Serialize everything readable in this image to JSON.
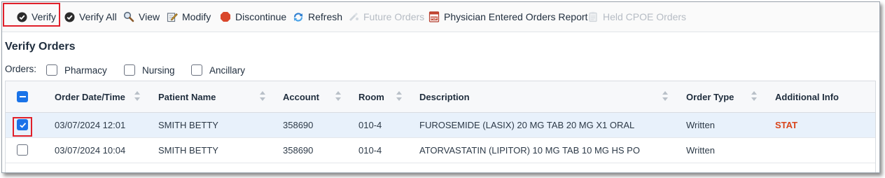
{
  "toolbar": {
    "items": [
      {
        "label": "Verify",
        "icon": "check-circle-icon",
        "enabled": true
      },
      {
        "label": "Verify All",
        "icon": "check-circle-icon",
        "enabled": true
      },
      {
        "label": "View",
        "icon": "magnifier-icon",
        "enabled": true
      },
      {
        "label": "Modify",
        "icon": "edit-note-icon",
        "enabled": true
      },
      {
        "label": "Discontinue",
        "icon": "stop-octagon-icon",
        "enabled": true
      },
      {
        "label": "Refresh",
        "icon": "refresh-icon",
        "enabled": true
      },
      {
        "label": "Future Orders",
        "icon": "future-orders-icon",
        "enabled": false
      },
      {
        "label": "Physician Entered Orders Report",
        "icon": "pdf-report-icon",
        "enabled": true
      },
      {
        "label": "Held CPOE Orders",
        "icon": "held-orders-icon",
        "enabled": false
      }
    ]
  },
  "page": {
    "title": "Verify Orders"
  },
  "filters": {
    "label": "Orders:",
    "options": [
      {
        "label": "Pharmacy",
        "checked": false
      },
      {
        "label": "Nursing",
        "checked": false
      },
      {
        "label": "Ancillary",
        "checked": false
      }
    ]
  },
  "table": {
    "columns": [
      "Order Date/Time",
      "Patient Name",
      "Account",
      "Room",
      "Description",
      "Order Type",
      "Additional Info"
    ],
    "rows": [
      {
        "checked": true,
        "selected": true,
        "date": "03/07/2024 12:01",
        "patient": "SMITH BETTY",
        "account": "358690",
        "room": "010-4",
        "description": "FUROSEMIDE (LASIX) 20 MG TAB 20 MG X1 ORAL",
        "order_type": "Written",
        "additional": "STAT"
      },
      {
        "checked": false,
        "selected": false,
        "date": "03/07/2024 10:04",
        "patient": "SMITH BETTY",
        "account": "358690",
        "room": "010-4",
        "description": "ATORVASTATIN (LIPITOR) 10 MG TAB 10 MG HS PO",
        "order_type": "Written",
        "additional": ""
      }
    ]
  },
  "colors": {
    "accent": "#1a73e8",
    "highlight": "#e0202a",
    "stat": "#d9451b",
    "selected_row": "#e8f1fb"
  }
}
